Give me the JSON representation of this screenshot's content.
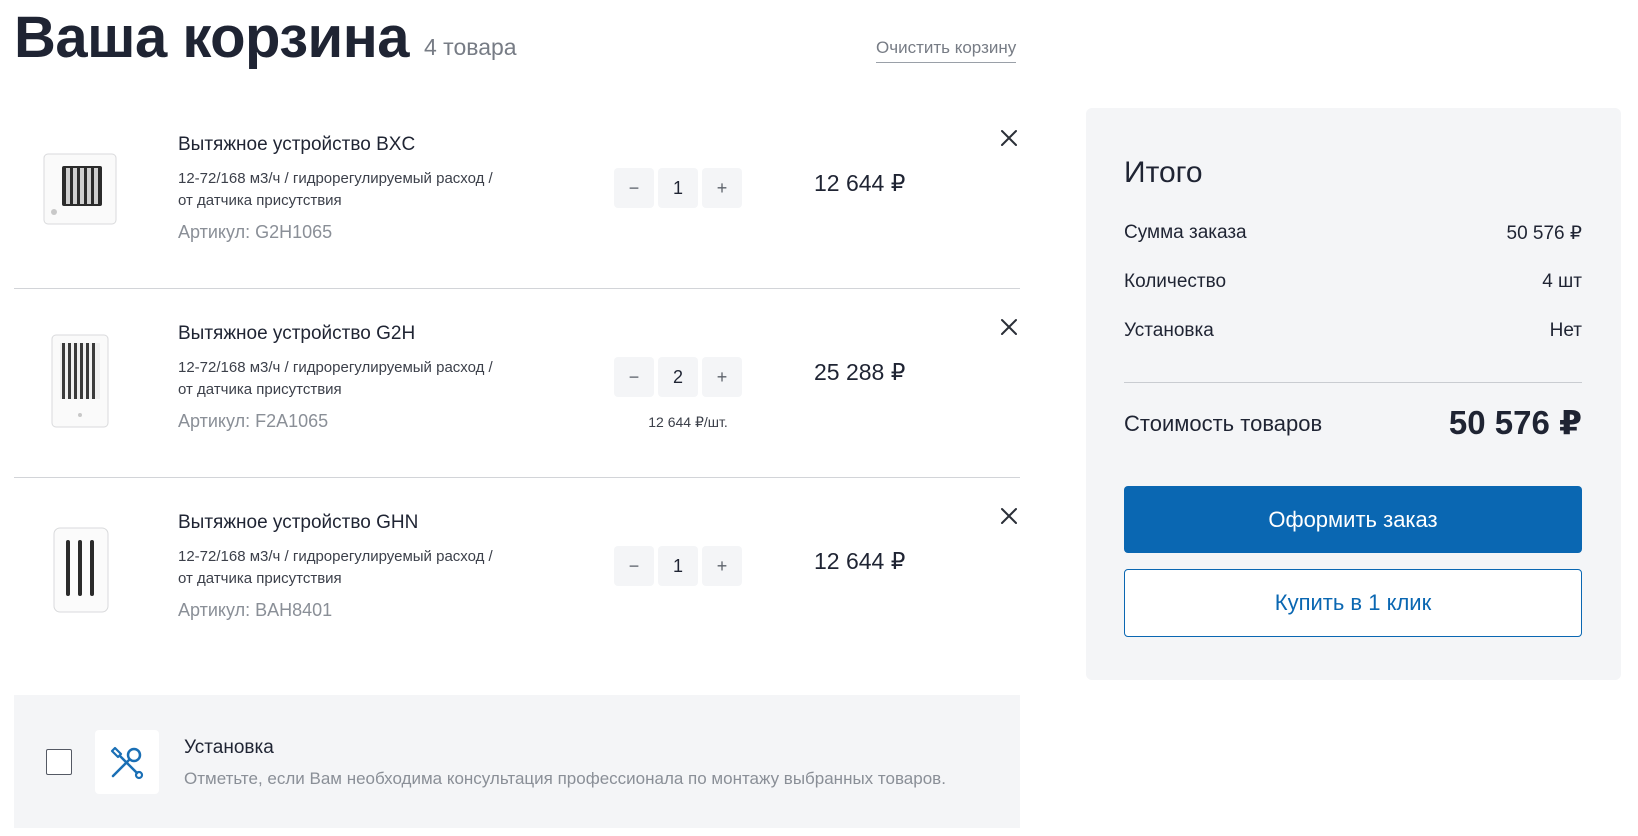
{
  "header": {
    "title": "Ваша корзина",
    "items_count": "4 товара",
    "clear_label": "Очистить корзину"
  },
  "items": [
    {
      "name": "Вытяжное устройство BXC",
      "desc_line1": "12-72/168 м3/ч / гидрорегулируемый расход /",
      "desc_line2": "от датчика присутствия",
      "sku": "Артикул: G2H1065",
      "qty": "1",
      "unit_price": "",
      "price": "12 644 ₽",
      "image_icon": "vent-bxc-image"
    },
    {
      "name": "Вытяжное устройство G2H",
      "desc_line1": "12-72/168 м3/ч / гидрорегулируемый расход /",
      "desc_line2": "от датчика присутствия",
      "sku": "Артикул: F2A1065",
      "qty": "2",
      "unit_price": "12 644 ₽/шт.",
      "price": "25 288 ₽",
      "image_icon": "vent-g2h-image"
    },
    {
      "name": "Вытяжное устройство GHN",
      "desc_line1": "12-72/168 м3/ч / гидрорегулируемый расход /",
      "desc_line2": "от датчика присутствия",
      "sku": "Артикул: BAH8401",
      "qty": "1",
      "unit_price": "",
      "price": "12 644 ₽",
      "image_icon": "vent-ghn-image"
    }
  ],
  "qty_controls": {
    "minus": "−",
    "plus": "+"
  },
  "install": {
    "title": "Установка",
    "description": "Отметьте, если Вам необходима консультация профессионала по монтажу выбранных товаров.",
    "checked": false,
    "icon": "tools-icon"
  },
  "summary": {
    "title": "Итого",
    "rows": [
      {
        "label": "Сумма заказа",
        "value": "50 576 ₽"
      },
      {
        "label": "Количество",
        "value": "4 шт"
      },
      {
        "label": "Установка",
        "value": "Нет"
      }
    ],
    "total_label": "Стоимость товаров",
    "total_value": "50 576 ₽",
    "checkout_label": "Оформить заказ",
    "oneclick_label": "Купить в 1 клик"
  },
  "colors": {
    "accent": "#0a67b2",
    "text": "#1f2433",
    "muted": "#8a8f97",
    "panel": "#f4f5f7"
  }
}
